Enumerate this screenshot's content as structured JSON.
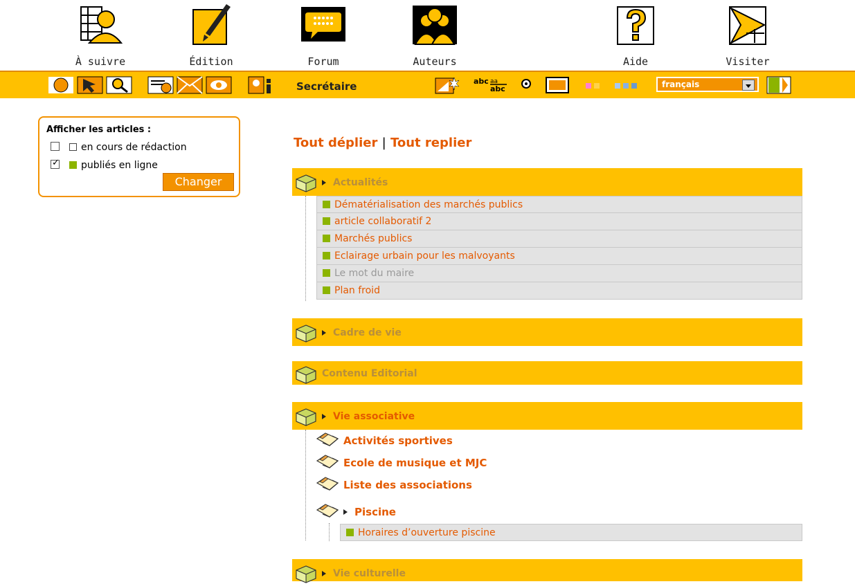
{
  "nav": {
    "items": [
      {
        "label": "À suivre",
        "icon": "suivre-icon"
      },
      {
        "label": "Édition",
        "icon": "edition-icon"
      },
      {
        "label": "Forum",
        "icon": "forum-icon"
      },
      {
        "label": "Auteurs",
        "icon": "auteurs-icon"
      },
      {
        "label": "Aide",
        "icon": "aide-icon"
      },
      {
        "label": "Visiter",
        "icon": "visiter-icon"
      }
    ]
  },
  "toolbar": {
    "role": "Secrétaire",
    "language": "français"
  },
  "filter": {
    "title": "Afficher les articles :",
    "options": [
      {
        "label": "en cours de rédaction",
        "checked": false
      },
      {
        "label": "publiés en ligne",
        "checked": true
      }
    ],
    "button": "Changer"
  },
  "toggles": {
    "expand": "Tout déplier",
    "separator": "|",
    "collapse": "Tout replier"
  },
  "rubriques": [
    {
      "name": "Actualités",
      "articles": [
        {
          "title": "Dématérialisation des marchés publics"
        },
        {
          "title": "article collaboratif 2"
        },
        {
          "title": "Marchés publics"
        },
        {
          "title": "Eclairage urbain pour les malvoyants"
        },
        {
          "title": "Le mot du maire"
        },
        {
          "title": "Plan froid"
        }
      ]
    },
    {
      "name": "Cadre de vie"
    },
    {
      "name": "Contenu Editorial"
    },
    {
      "name": "Vie associative",
      "subrubriques": [
        {
          "name": "Activités sportives"
        },
        {
          "name": "Ecole de musique et MJC"
        },
        {
          "name": "Liste des associations"
        },
        {
          "name": "Piscine",
          "articles": [
            {
              "title": "Horaires d’ouverture piscine"
            }
          ]
        }
      ]
    },
    {
      "name": "Vie culturelle"
    }
  ],
  "colors": {
    "accent": "#ffc000",
    "link": "#e45a00",
    "published": "#8cb400",
    "button": "#f39200"
  }
}
